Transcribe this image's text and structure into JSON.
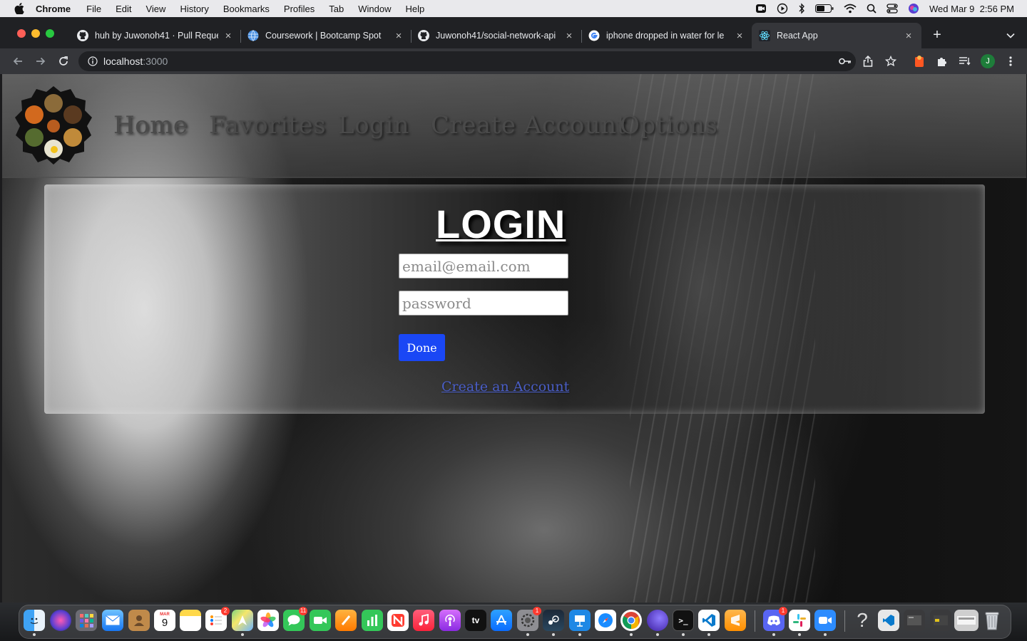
{
  "menubar": {
    "app_name": "Chrome",
    "menus": [
      "File",
      "Edit",
      "View",
      "History",
      "Bookmarks",
      "Profiles",
      "Tab",
      "Window",
      "Help"
    ],
    "datetime": "Wed Mar 9  2:56 PM"
  },
  "tabs": [
    {
      "title": "huh by Juwonoh41 · Pull Reque",
      "favicon": "github-icon"
    },
    {
      "title": "Coursework | Bootcamp Spot",
      "favicon": "globe-icon"
    },
    {
      "title": "Juwonoh41/social-network-api",
      "favicon": "github-icon"
    },
    {
      "title": "iphone dropped in water for le",
      "favicon": "google-icon"
    },
    {
      "title": "React App",
      "favicon": "react-icon",
      "active": true
    }
  ],
  "address_bar": {
    "host": "localhost",
    "port": ":3000"
  },
  "profile_initial": "J",
  "nav": {
    "links": [
      "Home",
      "Favorites",
      "Login",
      "Create Account",
      "Options"
    ]
  },
  "login": {
    "title": "LOGIN",
    "email_placeholder": "email@email.com",
    "password_placeholder": "password",
    "done_label": "Done",
    "create_link": "Create an Account"
  },
  "dock": {
    "calendar_month": "MAR",
    "calendar_day": "9",
    "tv_label": "tv",
    "badges": {
      "reminders": "2",
      "messages": "11",
      "system_prefs": "1",
      "discord": "1"
    }
  },
  "colors": {
    "done_button": "#1a47f5",
    "link": "#4a5ec7",
    "chrome_dark": "#202124",
    "chrome_toolbar": "#35363a"
  }
}
